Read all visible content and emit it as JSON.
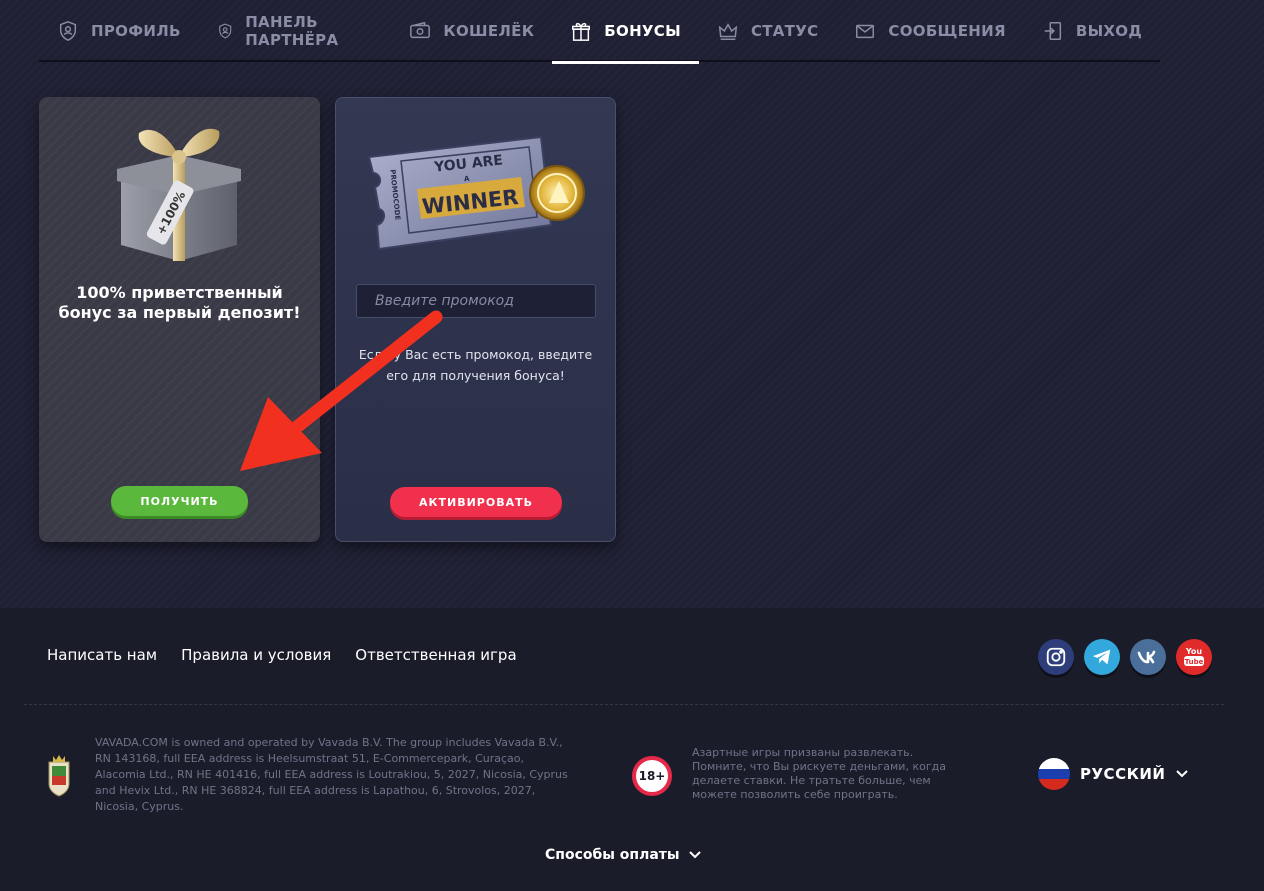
{
  "nav": {
    "items": [
      {
        "label": "ПРОФИЛЬ",
        "icon": "shield-user-icon",
        "active": false
      },
      {
        "label": "ПАНЕЛЬ ПАРТНЁРА",
        "icon": "shield-user-icon",
        "active": false
      },
      {
        "label": "КОШЕЛЁК",
        "icon": "wallet-icon",
        "active": false
      },
      {
        "label": "БОНУСЫ",
        "icon": "gift-icon",
        "active": true
      },
      {
        "label": "СТАТУС",
        "icon": "crown-icon",
        "active": false
      },
      {
        "label": "СООБЩЕНИЯ",
        "icon": "envelope-icon",
        "active": false
      },
      {
        "label": "ВЫХОД",
        "icon": "logout-icon",
        "active": false
      }
    ]
  },
  "welcome_card": {
    "title": "100% приветственный бонус за первый депозит!",
    "gift_tag": "+100%",
    "button_label": "ПОЛУЧИТЬ"
  },
  "promo_card": {
    "ticket_top": "YOU ARE",
    "ticket_mid": "A",
    "ticket_main": "WINNER",
    "ticket_side": "PROMOCODE",
    "input_placeholder": "Введите промокод",
    "hint": "Если у Вас есть промокод, введите его для получения бонуса!",
    "button_label": "АКТИВИРОВАТЬ"
  },
  "footer": {
    "links": [
      "Написать нам",
      "Правила и условия",
      "Ответственная игра"
    ],
    "socials": [
      {
        "name": "instagram",
        "color": "#2d3e7a"
      },
      {
        "name": "telegram",
        "color": "#33a8dc"
      },
      {
        "name": "vk",
        "color": "#4b6f9b"
      },
      {
        "name": "youtube",
        "color": "#e12b2b",
        "text": "You Tube"
      }
    ],
    "legal": "VAVADA.COM is owned and operated by Vavada B.V. The group includes Vavada B.V., RN 143168, full EEA address is Heelsumstraat 51, E-Commercepark, Curaçao, Alacomia Ltd., RN HE 401416, full EEA address is Loutrakiou, 5, 2027, Nicosia, Cyprus and Hevix Ltd., RN HE 368824, full EEA address is Lapathou, 6, Strovolos, 2027, Nicosia, Cyprus.",
    "age_badge": "18+",
    "gamble_note": "Азартные игры призваны развлекать. Помните, что Вы рискуете деньгами, когда делаете ставки. Не тратьте больше, чем можете позволить себе проиграть.",
    "language": "РУССКИЙ",
    "payments_label": "Способы оплаты"
  },
  "colors": {
    "accent_green": "#5ab83c",
    "accent_red": "#f0304d",
    "annotation_arrow": "#f2301f"
  }
}
